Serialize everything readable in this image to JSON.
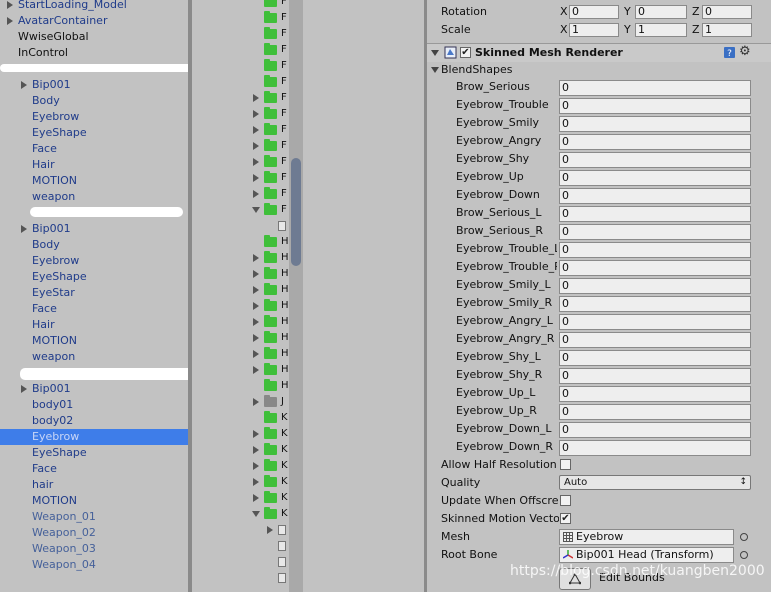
{
  "hierarchy": {
    "items": [
      {
        "label": "StartLoading_Model",
        "color": "blue",
        "arrow": true
      },
      {
        "label": "AvatarContainer",
        "color": "blue",
        "arrow": true
      },
      {
        "label": "WwiseGlobal",
        "color": "black",
        "arrow": false
      },
      {
        "label": "InControl",
        "color": "black",
        "arrow": false
      },
      {
        "label": "Bip001",
        "color": "blue",
        "arrow": true
      },
      {
        "label": "Body",
        "color": "blue",
        "arrow": false
      },
      {
        "label": "Eyebrow",
        "color": "blue",
        "arrow": false
      },
      {
        "label": "EyeShape",
        "color": "blue",
        "arrow": false
      },
      {
        "label": "Face",
        "color": "blue",
        "arrow": false
      },
      {
        "label": "Hair",
        "color": "blue",
        "arrow": false
      },
      {
        "label": "MOTION",
        "color": "blue",
        "arrow": false
      },
      {
        "label": "weapon",
        "color": "blue",
        "arrow": false
      },
      {
        "label": "Bip001",
        "color": "blue",
        "arrow": true
      },
      {
        "label": "Body",
        "color": "blue",
        "arrow": false
      },
      {
        "label": "Eyebrow",
        "color": "blue",
        "arrow": false
      },
      {
        "label": "EyeShape",
        "color": "blue",
        "arrow": false
      },
      {
        "label": "EyeStar",
        "color": "blue",
        "arrow": false
      },
      {
        "label": "Face",
        "color": "blue",
        "arrow": false
      },
      {
        "label": "Hair",
        "color": "blue",
        "arrow": false
      },
      {
        "label": "MOTION",
        "color": "blue",
        "arrow": false
      },
      {
        "label": "weapon",
        "color": "blue",
        "arrow": false
      },
      {
        "label": "Bip001",
        "color": "blue",
        "arrow": true
      },
      {
        "label": "body01",
        "color": "blue",
        "arrow": false
      },
      {
        "label": "body02",
        "color": "blue",
        "arrow": false
      },
      {
        "label": "Eyebrow",
        "color": "blue",
        "arrow": false,
        "selected": true
      },
      {
        "label": "EyeShape",
        "color": "blue",
        "arrow": false
      },
      {
        "label": "Face",
        "color": "blue",
        "arrow": false
      },
      {
        "label": "hair",
        "color": "blue",
        "arrow": false
      },
      {
        "label": "MOTION",
        "color": "blue",
        "arrow": false
      },
      {
        "label": "Weapon_01",
        "color": "grey",
        "arrow": false
      },
      {
        "label": "Weapon_02",
        "color": "grey",
        "arrow": false
      },
      {
        "label": "Weapon_03",
        "color": "grey",
        "arrow": false
      },
      {
        "label": "Weapon_04",
        "color": "grey",
        "arrow": false
      }
    ]
  },
  "project": {
    "rows": [
      {
        "label": "F",
        "folder": "green",
        "arrow": "none"
      },
      {
        "label": "F",
        "folder": "green",
        "arrow": "none"
      },
      {
        "label": "F",
        "folder": "green",
        "arrow": "none"
      },
      {
        "label": "F",
        "folder": "green",
        "arrow": "none"
      },
      {
        "label": "F",
        "folder": "green",
        "arrow": "none"
      },
      {
        "label": "F",
        "folder": "green",
        "arrow": "none"
      },
      {
        "label": "F",
        "folder": "green",
        "arrow": "right"
      },
      {
        "label": "F",
        "folder": "green",
        "arrow": "right"
      },
      {
        "label": "F",
        "folder": "green",
        "arrow": "right"
      },
      {
        "label": "F",
        "folder": "green",
        "arrow": "right"
      },
      {
        "label": "F",
        "folder": "green",
        "arrow": "right"
      },
      {
        "label": "F",
        "folder": "green",
        "arrow": "right"
      },
      {
        "label": "F",
        "folder": "green",
        "arrow": "right"
      },
      {
        "label": "F",
        "folder": "green",
        "arrow": "down"
      },
      {
        "label": "",
        "folder": "file",
        "arrow": "none"
      },
      {
        "label": "H",
        "folder": "green",
        "arrow": "none"
      },
      {
        "label": "H",
        "folder": "green",
        "arrow": "right"
      },
      {
        "label": "H",
        "folder": "green",
        "arrow": "right"
      },
      {
        "label": "H",
        "folder": "green",
        "arrow": "right"
      },
      {
        "label": "H",
        "folder": "green",
        "arrow": "right"
      },
      {
        "label": "H",
        "folder": "green",
        "arrow": "right"
      },
      {
        "label": "H",
        "folder": "green",
        "arrow": "right"
      },
      {
        "label": "H",
        "folder": "green",
        "arrow": "right"
      },
      {
        "label": "H",
        "folder": "green",
        "arrow": "right"
      },
      {
        "label": "H",
        "folder": "green",
        "arrow": "none"
      },
      {
        "label": "J",
        "folder": "grey",
        "arrow": "right"
      },
      {
        "label": "K",
        "folder": "green",
        "arrow": "none"
      },
      {
        "label": "K",
        "folder": "green",
        "arrow": "right"
      },
      {
        "label": "K",
        "folder": "green",
        "arrow": "right"
      },
      {
        "label": "K",
        "folder": "green",
        "arrow": "right"
      },
      {
        "label": "K",
        "folder": "green",
        "arrow": "right"
      },
      {
        "label": "K",
        "folder": "green",
        "arrow": "right"
      },
      {
        "label": "K",
        "folder": "green",
        "arrow": "down"
      },
      {
        "label": "",
        "folder": "file",
        "arrow": "right"
      },
      {
        "label": "",
        "folder": "file",
        "arrow": "none"
      },
      {
        "label": "",
        "folder": "file",
        "arrow": "none"
      },
      {
        "label": "",
        "folder": "file",
        "arrow": "none"
      }
    ]
  },
  "inspector": {
    "transform": {
      "rotation_label": "Rotation",
      "scale_label": "Scale",
      "x_label": "X",
      "y_label": "Y",
      "z_label": "Z",
      "rotation": {
        "x": "0",
        "y": "0",
        "z": "0"
      },
      "scale": {
        "x": "1",
        "y": "1",
        "z": "1"
      }
    },
    "component_title": "Skinned Mesh Renderer",
    "blendshapes_label": "BlendShapes",
    "blendshapes": [
      {
        "name": "Brow_Serious",
        "value": "0"
      },
      {
        "name": "Eyebrow_Trouble",
        "value": "0"
      },
      {
        "name": "Eyebrow_Smily",
        "value": "0"
      },
      {
        "name": "Eyebrow_Angry",
        "value": "0"
      },
      {
        "name": "Eyebrow_Shy",
        "value": "0"
      },
      {
        "name": "Eyebrow_Up",
        "value": "0"
      },
      {
        "name": "Eyebrow_Down",
        "value": "0"
      },
      {
        "name": "Brow_Serious_L",
        "value": "0"
      },
      {
        "name": "Brow_Serious_R",
        "value": "0"
      },
      {
        "name": "Eyebrow_Trouble_L",
        "value": "0"
      },
      {
        "name": "Eyebrow_Trouble_R",
        "value": "0"
      },
      {
        "name": "Eyebrow_Smily_L",
        "value": "0"
      },
      {
        "name": "Eyebrow_Smily_R",
        "value": "0"
      },
      {
        "name": "Eyebrow_Angry_L",
        "value": "0"
      },
      {
        "name": "Eyebrow_Angry_R",
        "value": "0"
      },
      {
        "name": "Eyebrow_Shy_L",
        "value": "0"
      },
      {
        "name": "Eyebrow_Shy_R",
        "value": "0"
      },
      {
        "name": "Eyebrow_Up_L",
        "value": "0"
      },
      {
        "name": "Eyebrow_Up_R",
        "value": "0"
      },
      {
        "name": "Eyebrow_Down_L",
        "value": "0"
      },
      {
        "name": "Eyebrow_Down_R",
        "value": "0"
      }
    ],
    "allow_half_label": "Allow Half Resolution",
    "quality_label": "Quality",
    "quality_value": "Auto",
    "update_offscreen_label": "Update When Offscreen",
    "skinned_motion_label": "Skinned Motion Vectors",
    "mesh_label": "Mesh",
    "mesh_value": "Eyebrow",
    "root_bone_label": "Root Bone",
    "root_bone_value": "Bip001 Head (Transform)",
    "edit_bounds_label": "Edit Bounds"
  },
  "watermark": "https://blog.csdn.net/kuangben2000"
}
